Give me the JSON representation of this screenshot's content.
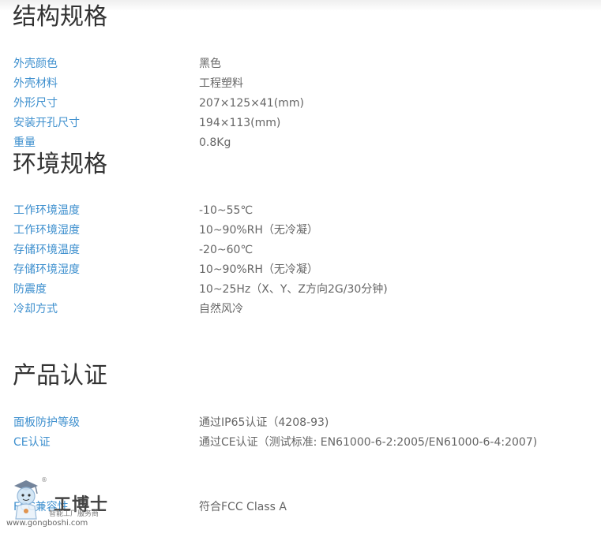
{
  "sections": [
    {
      "title": "结构规格",
      "rows": [
        {
          "label": "外壳颜色",
          "value": "黑色"
        },
        {
          "label": "外壳材料",
          "value": "工程塑料"
        },
        {
          "label": "外形尺寸",
          "value": "207×125×41(mm)"
        },
        {
          "label": "安装开孔尺寸",
          "value": "194×113(mm)"
        },
        {
          "label": "重量",
          "value": "0.8Kg"
        }
      ]
    },
    {
      "title": "环境规格",
      "rows": [
        {
          "label": "工作环境温度",
          "value": "-10~55℃"
        },
        {
          "label": "工作环境湿度",
          "value": "10~90%RH（无冷凝）"
        },
        {
          "label": "存储环境温度",
          "value": "-20~60℃"
        },
        {
          "label": "存储环境湿度",
          "value": "10~90%RH（无冷凝）"
        },
        {
          "label": "防震度",
          "value": "10~25Hz（X、Y、Z方向2G/30分钟)"
        },
        {
          "label": "冷却方式",
          "value": "自然风冷"
        }
      ]
    },
    {
      "title": "产品认证",
      "rows": [
        {
          "label": "面板防护等级",
          "value": "通过IP65认证（4208-93)"
        },
        {
          "label": "CE认证",
          "value": "通过CE认证（测试标准: EN61000-6-2:2005/EN61000-6-4:2007)"
        },
        {
          "label": "FCC兼容性",
          "value": "符合FCC Class A"
        }
      ]
    }
  ],
  "watermark": {
    "brand": "工博士",
    "subtitle": "智能工厂服务商",
    "url": "www.gongboshi.com",
    "registered": "®"
  },
  "colors": {
    "label": "#3d8fce",
    "value": "#666666",
    "title": "#333333"
  }
}
